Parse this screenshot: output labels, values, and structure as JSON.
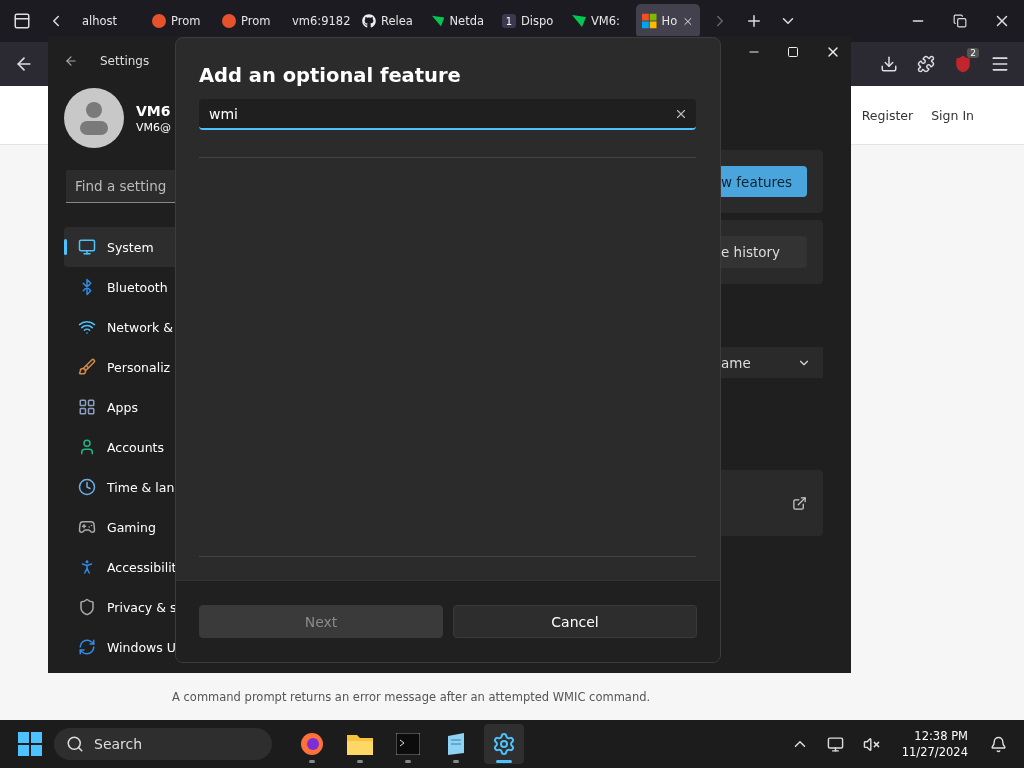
{
  "browser": {
    "tabs": [
      {
        "label": "alhost",
        "kind": "plain",
        "selected": false
      },
      {
        "label": "Prom",
        "kind": "prometheus",
        "selected": false
      },
      {
        "label": "Prom",
        "kind": "prometheus",
        "selected": false
      },
      {
        "label": "vm6:9182",
        "kind": "plain",
        "selected": false
      },
      {
        "label": "Relea",
        "kind": "github",
        "selected": false
      },
      {
        "label": "Netda",
        "kind": "netdata",
        "selected": false
      },
      {
        "label": "Dispo",
        "kind": "number",
        "badge": "1",
        "selected": false
      },
      {
        "label": "VM6:",
        "kind": "netdata",
        "selected": false
      },
      {
        "label": "Ho",
        "kind": "windows",
        "selected": true
      }
    ],
    "extension_badge": "2"
  },
  "page": {
    "header_links": [
      "Register",
      "Sign In"
    ],
    "caption": "A command prompt returns an error message after an attempted WMIC command."
  },
  "settings_window": {
    "title": "Settings",
    "user": {
      "name": "VM6",
      "email": "VM6@"
    },
    "search": {
      "placeholder": "Find a setting"
    },
    "nav": [
      {
        "label": "System",
        "kind": "system",
        "selected": true
      },
      {
        "label": "Bluetooth",
        "kind": "bluetooth",
        "selected": false
      },
      {
        "label": "Network &",
        "kind": "network",
        "selected": false
      },
      {
        "label": "Personaliz",
        "kind": "personalization",
        "selected": false
      },
      {
        "label": "Apps",
        "kind": "apps",
        "selected": false
      },
      {
        "label": "Accounts",
        "kind": "accounts",
        "selected": false
      },
      {
        "label": "Time & lan",
        "kind": "time",
        "selected": false
      },
      {
        "label": "Gaming",
        "kind": "gaming",
        "selected": false
      },
      {
        "label": "Accessibilit",
        "kind": "accessibility",
        "selected": false
      },
      {
        "label": "Privacy & s",
        "kind": "privacy",
        "selected": false
      },
      {
        "label": "Windows U",
        "kind": "update",
        "selected": false
      }
    ],
    "content": {
      "primary_button": "w features",
      "history_button": "e history",
      "dropdown": "ame"
    }
  },
  "dialog": {
    "title": "Add an optional feature",
    "search": {
      "value": "wmi"
    },
    "buttons": [
      {
        "label": "Next",
        "disabled": true
      },
      {
        "label": "Cancel",
        "disabled": false
      }
    ]
  },
  "taskbar": {
    "search_placeholder": "Search",
    "apps": [
      {
        "kind": "firefox",
        "selected": false
      },
      {
        "kind": "files",
        "selected": false
      },
      {
        "kind": "terminal",
        "selected": false
      },
      {
        "kind": "notepad",
        "selected": false
      },
      {
        "kind": "settings",
        "selected": true
      }
    ],
    "time": "12:38 PM",
    "date": "11/27/2024"
  }
}
